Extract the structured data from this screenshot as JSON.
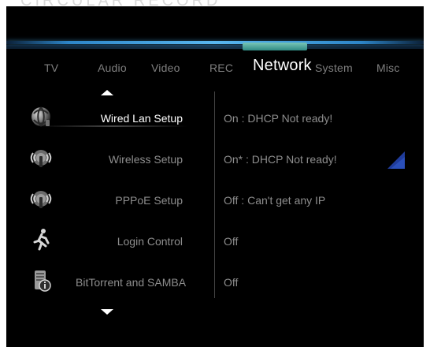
{
  "topbar": {
    "ghost_text": "CIRCULAR RECORD"
  },
  "tabs": [
    {
      "label": "TV",
      "active": false
    },
    {
      "label": "Audio",
      "active": false
    },
    {
      "label": "Video",
      "active": false
    },
    {
      "label": "REC",
      "active": false
    },
    {
      "label": "Network",
      "active": true
    },
    {
      "label": "System",
      "active": false
    },
    {
      "label": "Misc",
      "active": false
    }
  ],
  "menu": {
    "items": [
      {
        "icon": "globe-icon",
        "label": "Wired Lan Setup",
        "value": "On : DHCP Not ready!",
        "active": true
      },
      {
        "icon": "wireless-icon",
        "label": "Wireless Setup",
        "value": "On* : DHCP Not ready!",
        "active": false
      },
      {
        "icon": "pppoe-icon",
        "label": "PPPoE Setup",
        "value": "Off : Can't get any IP",
        "active": false
      },
      {
        "icon": "runner-icon",
        "label": "Login Control",
        "value": "Off",
        "active": false
      },
      {
        "icon": "server-info-icon",
        "label": "BitTorrent and SAMBA",
        "value": "Off",
        "active": false
      }
    ]
  },
  "indicators": {
    "up_arrow": "▲",
    "down_arrow": "▼",
    "signal_icon": "signal-strength-icon"
  },
  "colors": {
    "background": "#000000",
    "active_text": "#ffffff",
    "inactive_text": "#8d8d8d",
    "tab_inactive": "#7f7f7f",
    "accent_blue": "#59b7ef",
    "active_tab_bar": "#78c6b7",
    "signal_blue": "#203c9b"
  }
}
